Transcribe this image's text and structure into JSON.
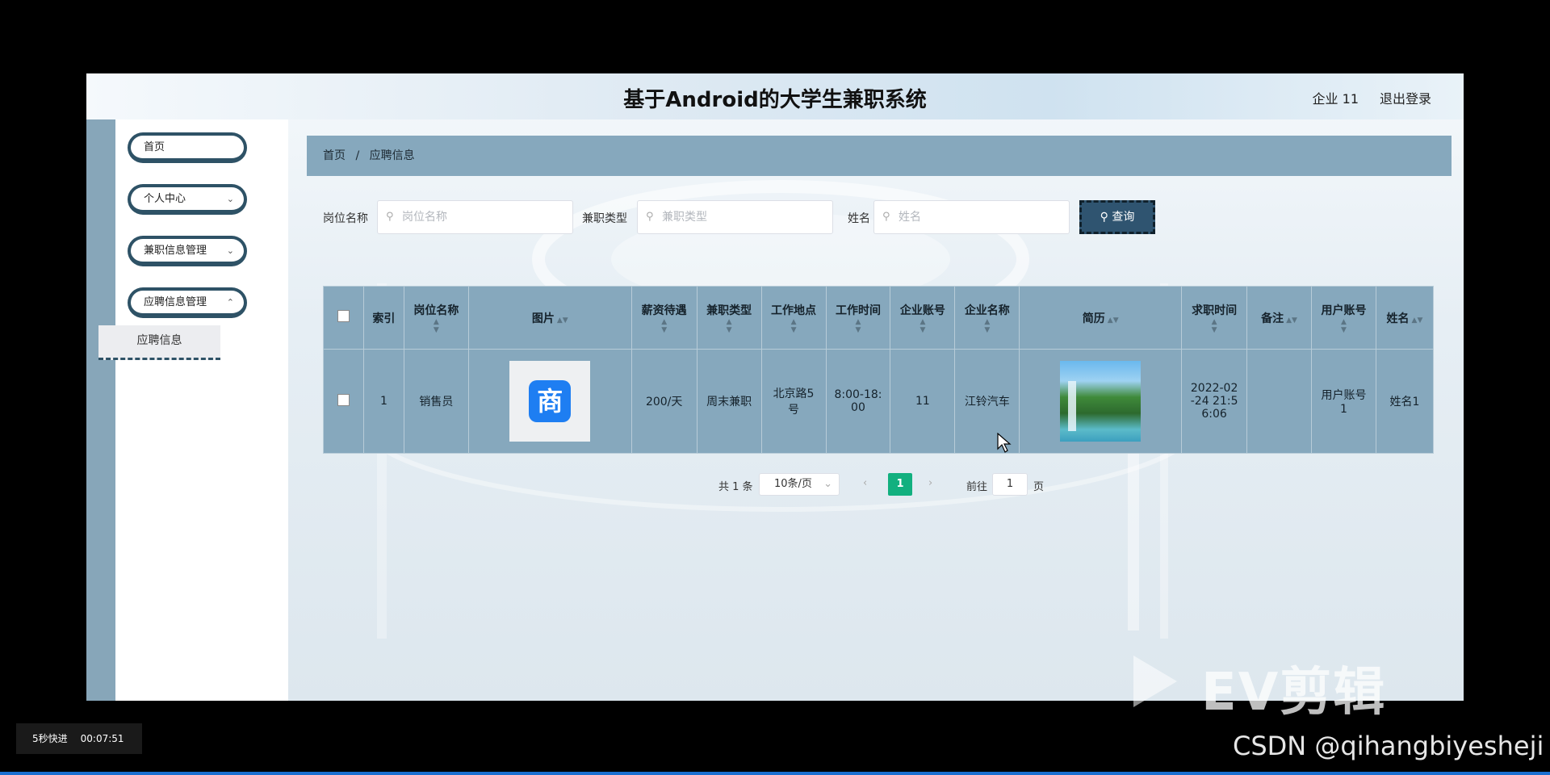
{
  "header": {
    "title": "基于Android的大学生兼职系统",
    "user": "企业 11",
    "logout": "退出登录"
  },
  "sidebar": {
    "items": [
      {
        "label": "首页"
      },
      {
        "label": "个人中心"
      },
      {
        "label": "兼职信息管理"
      },
      {
        "label": "应聘信息管理"
      }
    ],
    "sub_item": "应聘信息"
  },
  "breadcrumb": {
    "home": "首页",
    "sep": "/",
    "current": "应聘信息"
  },
  "filters": {
    "position_label": "岗位名称",
    "position_placeholder": "岗位名称",
    "type_label": "兼职类型",
    "type_placeholder": "兼职类型",
    "name_label": "姓名",
    "name_placeholder": "姓名",
    "search_button": "查询"
  },
  "table": {
    "headers": [
      "索引",
      "岗位名称",
      "图片",
      "薪资待遇",
      "兼职类型",
      "工作地点",
      "工作时间",
      "企业账号",
      "企业名称",
      "简历",
      "求职时间",
      "备注",
      "用户账号",
      "姓名"
    ],
    "rows": [
      {
        "index": "1",
        "position": "销售员",
        "image_icon_char": "商",
        "salary": "200/天",
        "type": "周末兼职",
        "location": "北京路5号",
        "time": "8:00-18:00",
        "company_account": "11",
        "company_name": "江铃汽车",
        "apply_time": "2022-02-24 21:56:06",
        "remark": "",
        "user_account": "用户账号1",
        "name": "姓名1"
      }
    ]
  },
  "pagination": {
    "total": "共 1 条",
    "page_size": "10条/页",
    "current_page": "1",
    "goto_label": "前往",
    "goto_value": "1",
    "goto_unit": "页"
  },
  "overlay": {
    "status_speed": "5秒快进",
    "status_time": "00:07:51",
    "watermark_ev": "EV剪辑",
    "watermark_csdn": "CSDN @qihangbiyesheji"
  },
  "colors": {
    "accent": "#86a8bd",
    "dark": "#2e5266",
    "page_active": "#12b07f",
    "shop_icon": "#1e7ef2"
  }
}
